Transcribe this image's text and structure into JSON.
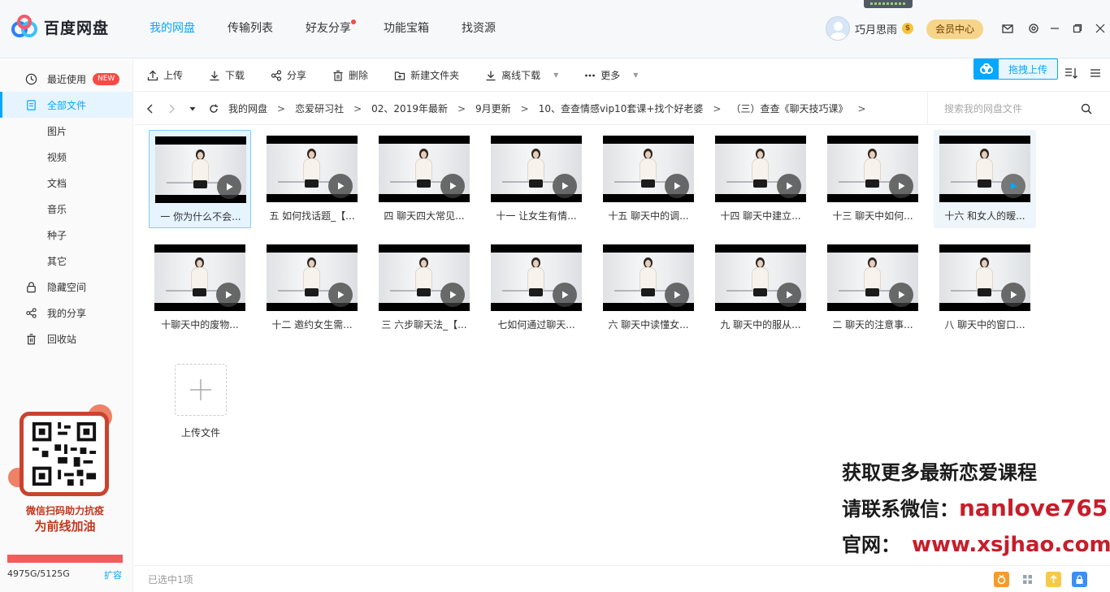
{
  "app": {
    "title": "百度网盘"
  },
  "nav": [
    {
      "label": "我的网盘",
      "active": true
    },
    {
      "label": "传输列表",
      "active": false
    },
    {
      "label": "好友分享",
      "active": false,
      "dot": true
    },
    {
      "label": "功能宝箱",
      "active": false
    },
    {
      "label": "找资源",
      "active": false
    }
  ],
  "user": {
    "name": "巧月思雨",
    "coin": "$",
    "member_label": "会员中心"
  },
  "sidebar": {
    "recent": {
      "label": "最近使用",
      "badge": "NEW"
    },
    "all_files": {
      "label": "全部文件"
    },
    "categories": [
      "图片",
      "视频",
      "文档",
      "音乐",
      "种子",
      "其它"
    ],
    "hidden_space": {
      "label": "隐藏空间"
    },
    "my_share": {
      "label": "我的分享"
    },
    "recycle": {
      "label": "回收站"
    },
    "promo": {
      "line1": "微信扫码助力抗疫",
      "line2": "为前线加油"
    },
    "quota": {
      "text": "4975G/5125G",
      "used_fraction": 0.97,
      "expand": "扩容"
    }
  },
  "toolbar": {
    "upload": "上传",
    "download": "下载",
    "share": "分享",
    "delete": "删除",
    "new_folder": "新建文件夹",
    "offline_download": "离线下载",
    "more": "更多",
    "drag_upload": "拖拽上传"
  },
  "breadcrumb": [
    "我的网盘",
    "恋爱研习社",
    "02、2019年最新",
    "9月更新",
    "10、查查情感vip10套课+找个好老婆",
    "（三）查查《聊天技巧课》"
  ],
  "search": {
    "placeholder": "搜索我的网盘文件"
  },
  "files": [
    {
      "name": "一 你为什么不会...",
      "selected": true
    },
    {
      "name": "五 如何找话题_【..."
    },
    {
      "name": "四 聊天四大常见..."
    },
    {
      "name": "十一 让女生有情..."
    },
    {
      "name": "十五 聊天中的调..."
    },
    {
      "name": "十四 聊天中建立..."
    },
    {
      "name": "十三 聊天中如何..."
    },
    {
      "name": "十六 和女人的暧...",
      "hover": true
    },
    {
      "name": "十聊天中的废物..."
    },
    {
      "name": "十二 邀约女生需..."
    },
    {
      "name": "三 六步聊天法_【..."
    },
    {
      "name": "七如何通过聊天..."
    },
    {
      "name": "六 聊天中读懂女..."
    },
    {
      "name": "九 聊天中的服从..."
    },
    {
      "name": "二 聊天的注意事..."
    },
    {
      "name": "八 聊天中的窗口..."
    }
  ],
  "upload_tile": {
    "label": "上传文件"
  },
  "watermark": {
    "line1": "获取更多最新恋爱课程",
    "line2_prefix": "请联系微信：",
    "line2_value": "nanlove765",
    "line3_prefix": "官网：",
    "line3_value": "www.xsjhao.com"
  },
  "status": {
    "selection": "已选中1项"
  },
  "colors": {
    "accent": "#06a7ff",
    "quota": "#f25c5c",
    "watermark_red": "#c61e2b"
  }
}
